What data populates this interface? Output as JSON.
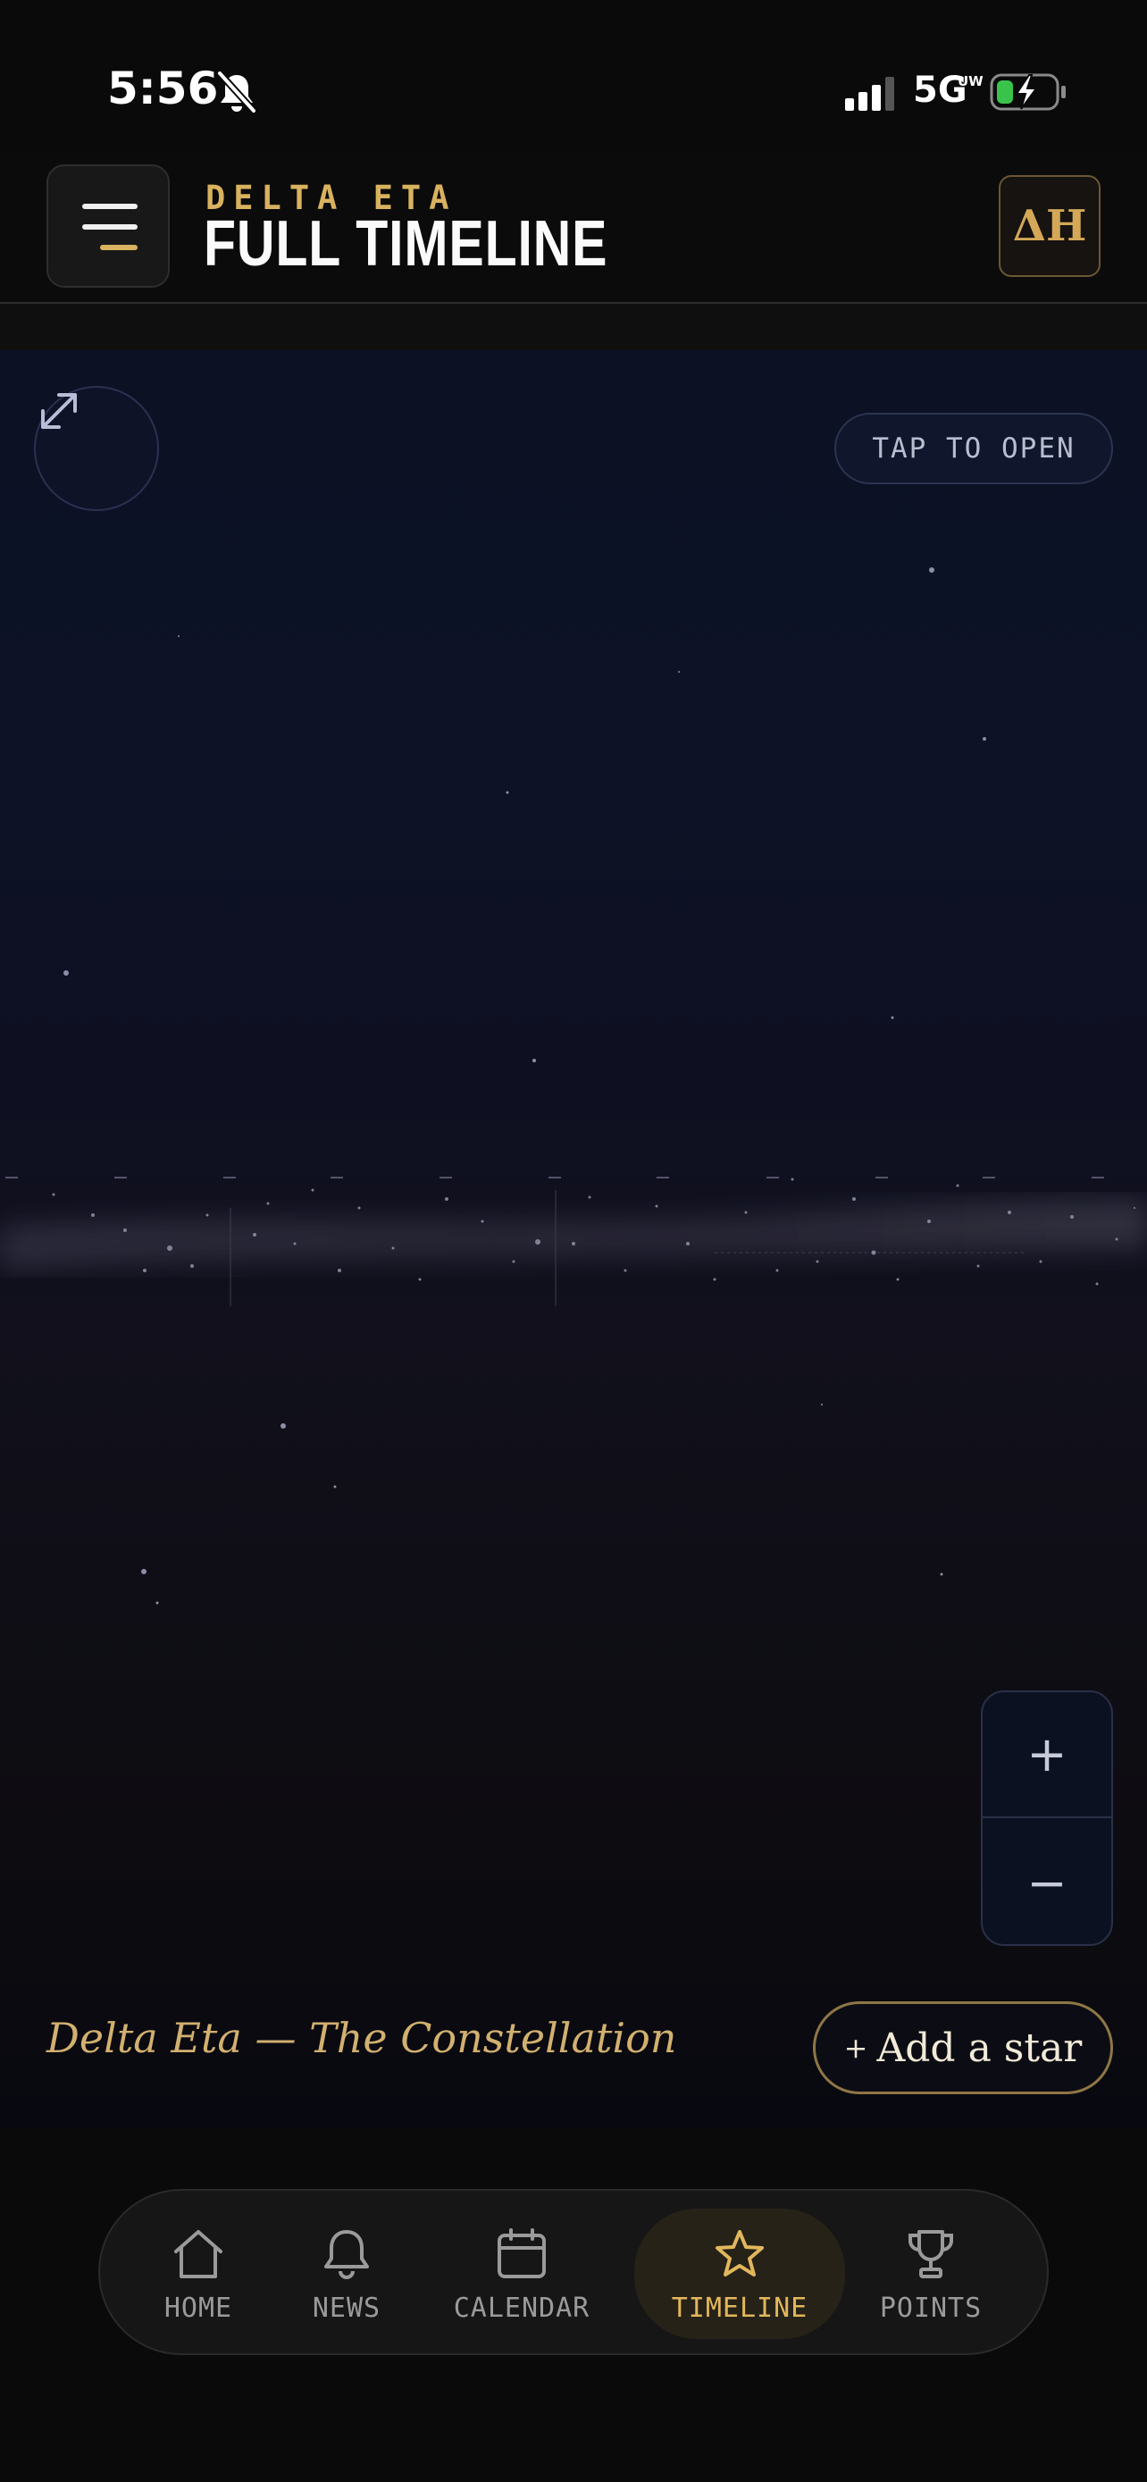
{
  "status_bar": {
    "time": "5:56",
    "network": "5G",
    "network_sub": "UW",
    "icons": [
      "bell-off-icon",
      "signal-icon",
      "battery-charging-icon"
    ]
  },
  "header": {
    "org_name": "DELTA ETA",
    "title": "FULL TIMELINE",
    "logo_text": "ΔΗ",
    "menu_icon": "menu-icon"
  },
  "sky": {
    "tap_hint": "TAP TO OPEN",
    "expand_icon": "expand-icon",
    "zoom_in": "+",
    "zoom_out": "−",
    "caption": "Delta Eta — The Constellation",
    "add_plus": "+",
    "add_label": "Add a star"
  },
  "nav": {
    "tabs": [
      {
        "label": "HOME",
        "icon": "home-icon",
        "active": false
      },
      {
        "label": "NEWS",
        "icon": "bell-icon",
        "active": false
      },
      {
        "label": "CALENDAR",
        "icon": "calendar-icon",
        "active": false
      },
      {
        "label": "TIMELINE",
        "icon": "star-icon",
        "active": true
      },
      {
        "label": "POINTS",
        "icon": "trophy-icon",
        "active": false
      }
    ]
  },
  "colors": {
    "accent_gold": "#d9b25f",
    "sky_top": "#0c1124",
    "sky_bottom": "#080910",
    "inactive_tab": "#9a9a9a"
  }
}
